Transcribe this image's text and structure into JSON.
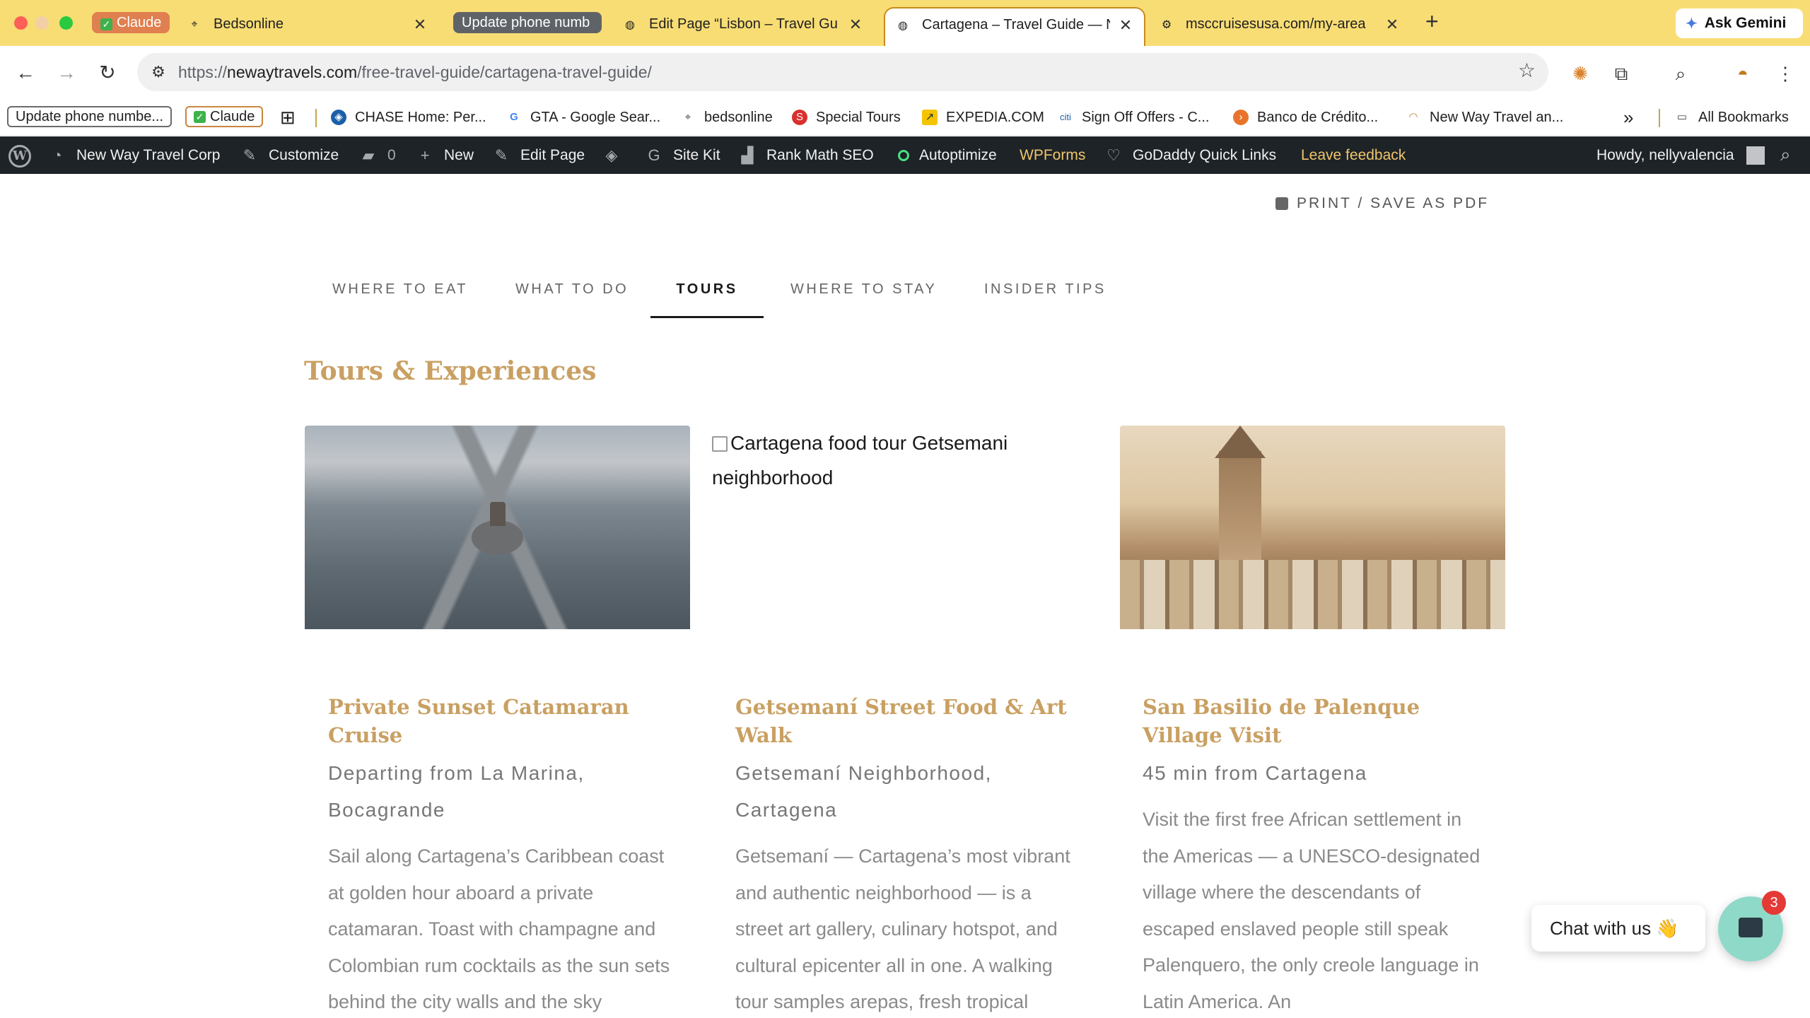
{
  "browser": {
    "tab_groups": {
      "claude_group": "Claude",
      "update_group": "Update phone numb"
    },
    "tabs": [
      {
        "title": "Bedsonline",
        "icon": "location-pin-icon"
      },
      {
        "title": "Edit Page “Lisbon – Travel Gu",
        "icon": "globe-icon"
      },
      {
        "title": "Cartagena – Travel Guide — N",
        "icon": "globe-icon",
        "active": true
      },
      {
        "title": "msccruisesusa.com/my-area",
        "icon": "gear-icon"
      }
    ],
    "new_tab": "+",
    "ask_gemini": "Ask Gemini",
    "url_prefix": "https://",
    "url_host": "newaytravels.com",
    "url_path": "/free-travel-guide/cartagena-travel-guide/"
  },
  "bookmarks": [
    {
      "label": "Update phone numbe..."
    },
    {
      "label": "Claude"
    },
    {
      "label": "CHASE Home: Per..."
    },
    {
      "label": "GTA - Google Sear..."
    },
    {
      "label": "bedsonline"
    },
    {
      "label": "Special Tours"
    },
    {
      "label": "EXPEDIA.COM"
    },
    {
      "label": "Sign Off Offers - C..."
    },
    {
      "label": "Banco de Crédito..."
    },
    {
      "label": "New Way Travel an..."
    }
  ],
  "bookmarks_more": "»",
  "all_bookmarks": "All Bookmarks",
  "wp_admin": {
    "site_name": "New Way Travel Corp",
    "customize": "Customize",
    "comments_count": "0",
    "new": "New",
    "edit_page": "Edit Page",
    "site_kit": "Site Kit",
    "rank_math": "Rank Math SEO",
    "autoptimize": "Autoptimize",
    "wpforms": "WPForms",
    "godaddy": "GoDaddy Quick Links",
    "feedback": "Leave feedback",
    "howdy": "Howdy, nellyvalencia"
  },
  "page": {
    "print_label": "PRINT / SAVE AS PDF",
    "nav_tabs": [
      "WHERE TO EAT",
      "WHAT TO DO",
      "TOURS",
      "WHERE TO STAY",
      "INSIDER TIPS"
    ],
    "active_tab": "TOURS",
    "section_title": "Tours & Experiences",
    "cards": [
      {
        "title": "Private Sunset Catamaran Cruise",
        "location": "Departing from La Marina, Bocagrande",
        "description": "Sail along Cartagena’s Caribbean coast at golden hour aboard a private catamaran. Toast with champagne and Colombian rum cocktails as the sun sets behind the city walls and the sky"
      },
      {
        "image_alt": "Cartagena food tour Getsemani neighborhood",
        "title": "Getsemaní Street Food & Art Walk",
        "location": "Getsemaní Neighborhood, Cartagena",
        "description": "Getsemaní — Cartagena’s most vibrant and authentic neighborhood — is a street art gallery, culinary hotspot, and cultural epicenter all in one. A walking tour samples arepas, fresh tropical"
      },
      {
        "title": "San Basilio de Palenque Village Visit",
        "location": "45 min from Cartagena",
        "description": "Visit the first free African settlement in the Americas — a UNESCO-designated village where the descendants of escaped enslaved people still speak Palenquero, the only creole language in Latin America. An"
      }
    ]
  },
  "chat": {
    "label": "Chat with us 👋",
    "badge": "3"
  },
  "colors": {
    "tab_strip": "#f8dd75",
    "wp_bar": "#1d2327",
    "gold_heading": "#c9a062"
  }
}
